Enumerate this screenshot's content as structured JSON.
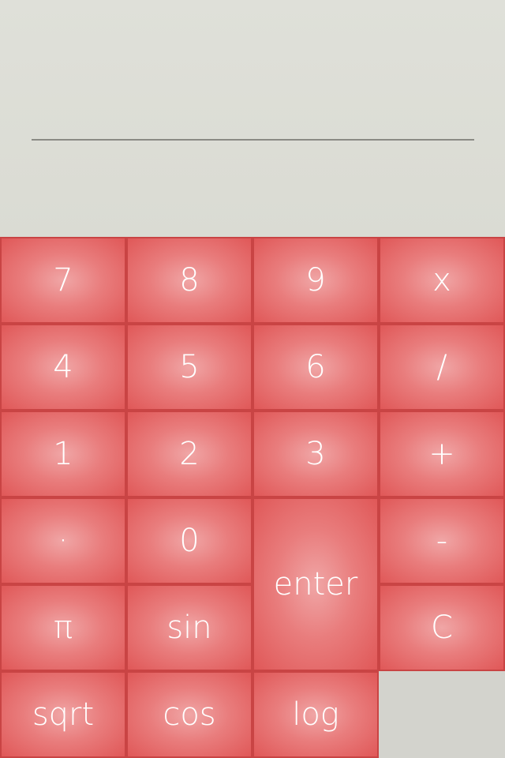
{
  "display": {
    "value": ""
  },
  "keys": {
    "k7": "7",
    "k8": "8",
    "k9": "9",
    "multiply": "x",
    "k4": "4",
    "k5": "5",
    "k6": "6",
    "divide": "/",
    "k1": "1",
    "k2": "2",
    "k3": "3",
    "plus": "+",
    "dot": "·",
    "k0": "0",
    "enter": "enter",
    "minus": "-",
    "pi": "π",
    "sin": "sin",
    "clear": "C",
    "sqrt": "sqrt",
    "cos": "cos",
    "log": "log"
  },
  "colors": {
    "key_red": "#e05858",
    "key_center": "#f0a6a6",
    "key_border": "#c94444",
    "display_bg": "#dcddd5"
  }
}
